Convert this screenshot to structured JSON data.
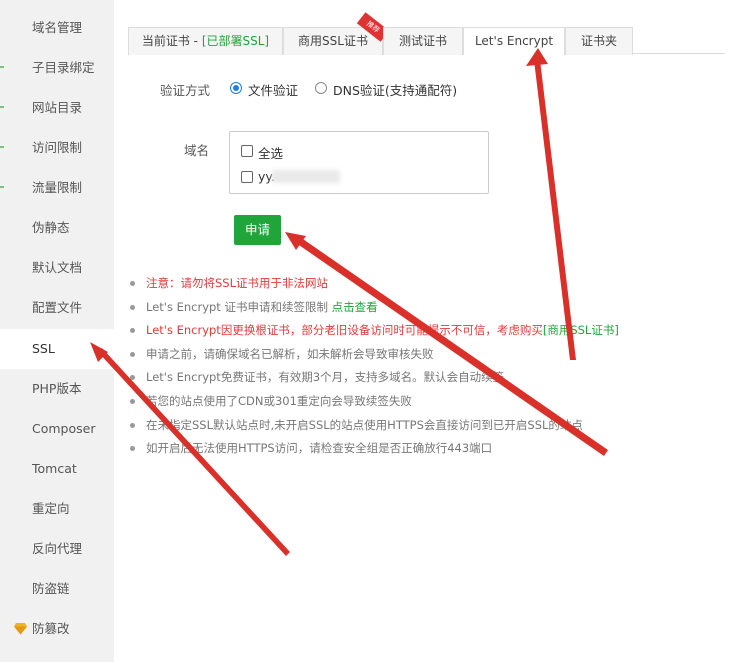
{
  "sidebar": {
    "items": [
      {
        "label": "域名管理"
      },
      {
        "label": "子目录绑定"
      },
      {
        "label": "网站目录"
      },
      {
        "label": "访问限制"
      },
      {
        "label": "流量限制"
      },
      {
        "label": "伪静态"
      },
      {
        "label": "默认文档"
      },
      {
        "label": "配置文件"
      },
      {
        "label": "SSL"
      },
      {
        "label": "PHP版本"
      },
      {
        "label": "Composer"
      },
      {
        "label": "Tomcat"
      },
      {
        "label": "重定向"
      },
      {
        "label": "反向代理"
      },
      {
        "label": "防盗链"
      },
      {
        "label": "防篡改"
      }
    ],
    "active_index": 8
  },
  "tabs": {
    "current_prefix": "当前证书 - ",
    "current_status": "[已部署SSL]",
    "commercial": "商用SSL证书",
    "commercial_badge": "推荐",
    "test": "测试证书",
    "letsencrypt": "Let's Encrypt",
    "folder": "证书夹"
  },
  "form": {
    "verify_label": "验证方式",
    "verify_options": [
      {
        "label": "文件验证",
        "checked": true
      },
      {
        "label": "DNS验证(支持通配符)",
        "checked": false
      }
    ],
    "domain_label": "域名",
    "select_all": "全选",
    "domain_entry": "yy.",
    "apply_button": "申请"
  },
  "notes": [
    {
      "text": "注意：请勿将SSL证书用于非法网站",
      "style": "red"
    },
    {
      "text": "Let's Encrypt 证书申请和续签限制 ",
      "link": "点击查看",
      "style": "normal"
    },
    {
      "text": "Let's Encrypt因更换根证书，部分老旧设备访问时可能提示不可信，考虑购买",
      "link": "[商用SSL证书]",
      "style": "red"
    },
    {
      "text": "申请之前，请确保域名已解析，如未解析会导致审核失败",
      "style": "normal"
    },
    {
      "text": "Let's Encrypt免费证书，有效期3个月，支持多域名。默认会自动续签",
      "style": "normal"
    },
    {
      "text": "若您的站点使用了CDN或301重定向会导致续签失败",
      "style": "normal"
    },
    {
      "text": "在未指定SSL默认站点时,未开启SSL的站点使用HTTPS会直接访问到已开启SSL的站点",
      "style": "normal"
    },
    {
      "text": "如开启后无法使用HTTPS访问，请检查安全组是否正确放行443端口",
      "style": "normal"
    }
  ],
  "colors": {
    "accent_green": "#20a53a",
    "warning_red": "#e4393c",
    "annotation_red": "#d9302a",
    "radio_blue": "#1e7ee8"
  }
}
